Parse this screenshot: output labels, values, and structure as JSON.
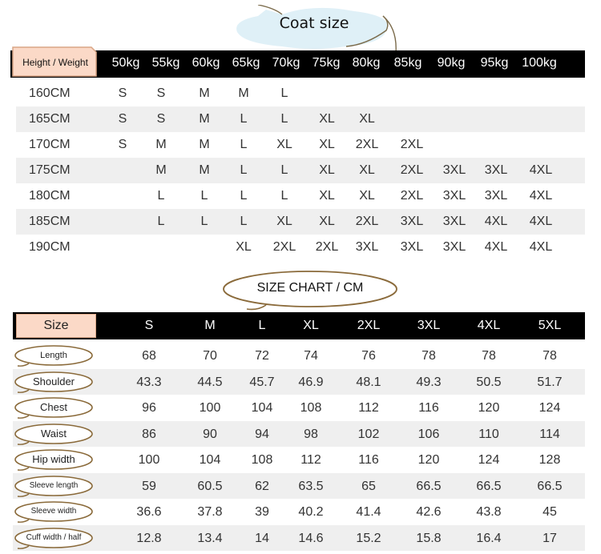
{
  "coat": {
    "title": "Coat size",
    "corner_label": "Height  / Weight",
    "weights": [
      "50kg",
      "55kg",
      "60kg",
      "65kg",
      "70kg",
      "75kg",
      "80kg",
      "85kg",
      "90kg",
      "95kg",
      "100kg"
    ],
    "rows": [
      {
        "height": "160CM",
        "sizes": [
          "S",
          "S",
          "M",
          "M",
          "L",
          "",
          "",
          "",
          "",
          "",
          ""
        ]
      },
      {
        "height": "165CM",
        "sizes": [
          "S",
          "S",
          "M",
          "L",
          "L",
          "XL",
          "XL",
          "",
          "",
          "",
          ""
        ]
      },
      {
        "height": "170CM",
        "sizes": [
          "S",
          "M",
          "M",
          "L",
          "XL",
          "XL",
          "2XL",
          "2XL",
          "",
          "",
          ""
        ]
      },
      {
        "height": "175CM",
        "sizes": [
          "",
          "M",
          "M",
          "L",
          "L",
          "XL",
          "XL",
          "2XL",
          "3XL",
          "3XL",
          "4XL"
        ]
      },
      {
        "height": "180CM",
        "sizes": [
          "",
          "L",
          "L",
          "L",
          "L",
          "XL",
          "XL",
          "2XL",
          "3XL",
          "3XL",
          "4XL"
        ]
      },
      {
        "height": "185CM",
        "sizes": [
          "",
          "L",
          "L",
          "L",
          "XL",
          "XL",
          "2XL",
          "3XL",
          "3XL",
          "4XL",
          "4XL"
        ]
      },
      {
        "height": "190CM",
        "sizes": [
          "",
          "",
          "",
          "XL",
          "2XL",
          "2XL",
          "3XL",
          "3XL",
          "3XL",
          "4XL",
          "4XL"
        ]
      }
    ]
  },
  "chart": {
    "title": "SIZE CHART / CM",
    "corner_label": "Size",
    "sizes": [
      "S",
      "M",
      "L",
      "XL",
      "2XL",
      "3XL",
      "4XL",
      "5XL"
    ],
    "rows": [
      {
        "label": "Length",
        "values": [
          "68",
          "70",
          "72",
          "74",
          "76",
          "78",
          "78",
          "78"
        ]
      },
      {
        "label": "Shoulder",
        "values": [
          "43.3",
          "44.5",
          "45.7",
          "46.9",
          "48.1",
          "49.3",
          "50.5",
          "51.7"
        ]
      },
      {
        "label": "Chest",
        "values": [
          "96",
          "100",
          "104",
          "108",
          "112",
          "116",
          "120",
          "124"
        ]
      },
      {
        "label": "Waist",
        "values": [
          "86",
          "90",
          "94",
          "98",
          "102",
          "106",
          "110",
          "114"
        ]
      },
      {
        "label": "Hip width",
        "values": [
          "100",
          "104",
          "108",
          "112",
          "116",
          "120",
          "124",
          "128"
        ]
      },
      {
        "label": "Sleeve length",
        "values": [
          "59",
          "60.5",
          "62",
          "63.5",
          "65",
          "66.5",
          "66.5",
          "66.5"
        ]
      },
      {
        "label": "Sleeve width",
        "values": [
          "36.6",
          "37.8",
          "39",
          "40.2",
          "41.4",
          "42.6",
          "43.8",
          "45"
        ]
      },
      {
        "label": "Cuff width / half",
        "values": [
          "12.8",
          "13.4",
          "14",
          "14.6",
          "15.2",
          "15.8",
          "16.4",
          "17"
        ]
      }
    ]
  },
  "colors": {
    "header_bg": "#000000",
    "row_shade": "#efefef",
    "tag_fill": "#fbd9c7",
    "oval_stroke": "#8a6a3a",
    "bubble_fill": "#dff0f7"
  }
}
